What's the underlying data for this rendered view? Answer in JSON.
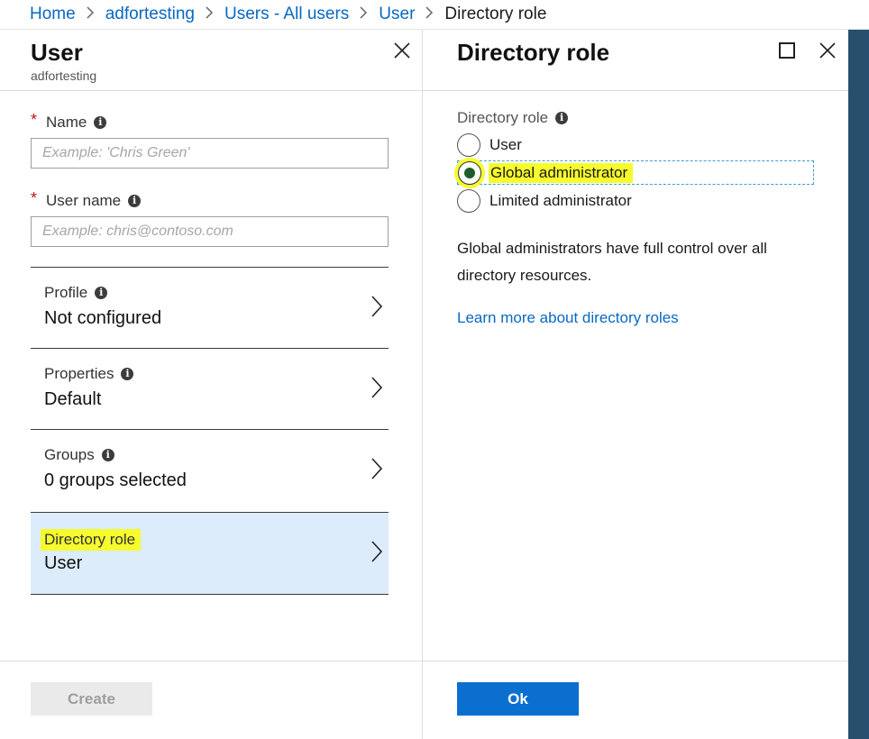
{
  "breadcrumb": {
    "items": [
      "Home",
      "adfortesting",
      "Users - All users",
      "User"
    ],
    "current": "Directory role"
  },
  "user_blade": {
    "title": "User",
    "subtitle": "adfortesting",
    "name_field": {
      "label": "Name",
      "placeholder": "Example: 'Chris Green'",
      "value": ""
    },
    "username_field": {
      "label": "User name",
      "placeholder": "Example: chris@contoso.com",
      "value": ""
    },
    "rows": [
      {
        "label": "Profile",
        "value": "Not configured"
      },
      {
        "label": "Properties",
        "value": "Default"
      },
      {
        "label": "Groups",
        "value": "0 groups selected"
      },
      {
        "label": "Directory role",
        "value": "User"
      }
    ],
    "create_label": "Create"
  },
  "role_blade": {
    "title": "Directory role",
    "field_label": "Directory role",
    "options": [
      "User",
      "Global administrator",
      "Limited administrator"
    ],
    "selected": "Global administrator",
    "description": "Global administrators have full control over all directory resources.",
    "learn_more": "Learn more about directory roles",
    "ok_label": "Ok"
  },
  "colors": {
    "accent": "#0b6fd0",
    "link": "#0a68c2",
    "highlight": "#f6fb2d",
    "edge": "#26506e",
    "active_row": "#dcecfb"
  }
}
